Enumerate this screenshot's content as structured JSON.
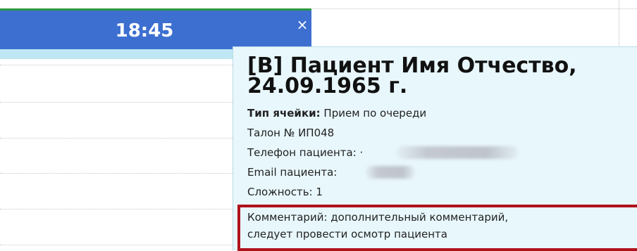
{
  "slot": {
    "time": "18:45",
    "close_label": "×"
  },
  "tooltip": {
    "title": "[В] Пациент Имя Отчество, 24.09.1965 г.",
    "cell_type_label": "Тип ячейки:",
    "cell_type_value": "Прием по очереди",
    "ticket": "Талон № ИП048",
    "phone_label": "Телефон пациента: ·",
    "email_label": "Email пациента:",
    "complexity": "Сложность: 1",
    "comment_line1": "Комментарий: дополнительный комментарий,",
    "comment_line2": "следует провести осмотр пациента"
  },
  "colors": {
    "header_blue": "#3c6fd0",
    "header_top_green": "#2e9a3e",
    "tooltip_bg": "#e8f7fc",
    "highlight_red": "#b0121c"
  }
}
